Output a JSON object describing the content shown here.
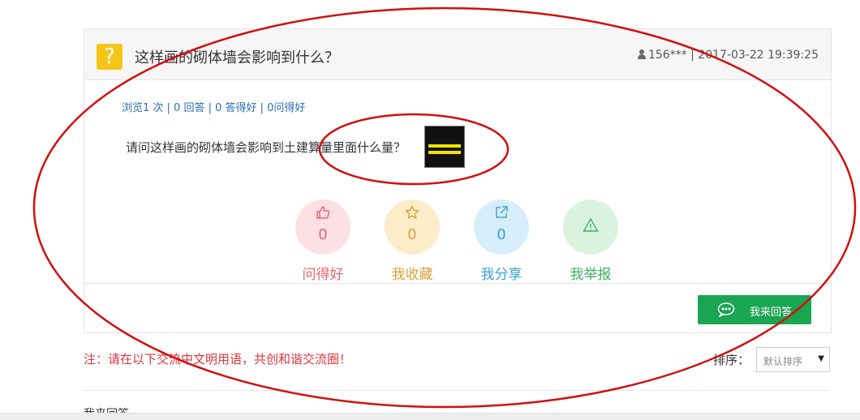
{
  "question": {
    "badge": "?",
    "title": "这样画的砌体墙会影响到什么？",
    "user": "156***",
    "separator": "|",
    "datetime": "2017-03-22 19:39:25",
    "stats": "浏览1 次 | 0 回答 | 0 答得好 | 0问得好",
    "body": "请问这样画的砌体墙会影响到土建算量里面什么量？"
  },
  "actions": [
    {
      "label": "问得好",
      "count": "0",
      "icon": "thumb-up-icon",
      "color": "#e8656f"
    },
    {
      "label": "我收藏",
      "count": "0",
      "icon": "star-icon",
      "color": "#d9a13b"
    },
    {
      "label": "我分享",
      "count": "0",
      "icon": "share-icon",
      "color": "#3aa0d8"
    },
    {
      "label": "我举报",
      "count": "0",
      "icon": "warning-icon",
      "color": "#3db160"
    }
  ],
  "answer_button": {
    "label": "我来回答",
    "icon": "chat-bubble-icon",
    "color": "#1aa552"
  },
  "notice": "注：请在以下交流中文明用语，共创和谐交流圈！",
  "sort": {
    "label": "排序：",
    "selected": "默认排序"
  },
  "footer_section": "我来回答",
  "annotation_color": "#d01010"
}
